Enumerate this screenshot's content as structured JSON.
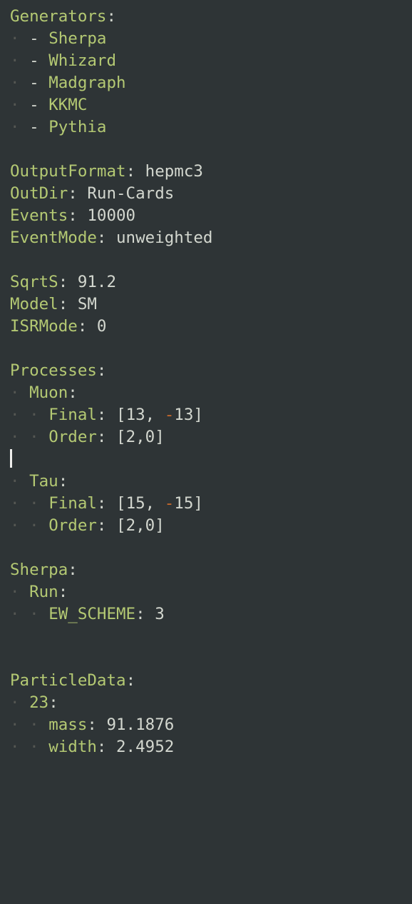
{
  "Generators": [
    "Sherpa",
    "Whizard",
    "Madgraph",
    "KKMC",
    "Pythia"
  ],
  "OutputFormat": "hepmc3",
  "OutDir": "Run-Cards",
  "Events": 10000,
  "EventMode": "unweighted",
  "SqrtS": 91.2,
  "Model": "SM",
  "ISRMode": 0,
  "Processes": {
    "Muon": {
      "Final": [
        13,
        -13
      ],
      "Order": [
        2,
        0
      ]
    },
    "Tau": {
      "Final": [
        15,
        -15
      ],
      "Order": [
        2,
        0
      ]
    }
  },
  "Sherpa": {
    "Run": {
      "EW_SCHEME": 3
    }
  },
  "ParticleData": {
    "23": {
      "mass": 91.1876,
      "width": 2.4952
    }
  },
  "labels": {
    "Generators": "Generators",
    "OutputFormat": "OutputFormat",
    "OutDir": "OutDir",
    "Events": "Events",
    "EventMode": "EventMode",
    "SqrtS": "SqrtS",
    "Model": "Model",
    "ISRMode": "ISRMode",
    "Processes": "Processes",
    "Muon": "Muon",
    "Tau": "Tau",
    "Final": "Final",
    "Order": "Order",
    "Sherpa": "Sherpa",
    "Run": "Run",
    "EW_SCHEME": "EW_SCHEME",
    "ParticleData": "ParticleData",
    "k23": "23",
    "mass": "mass",
    "width": "width"
  }
}
